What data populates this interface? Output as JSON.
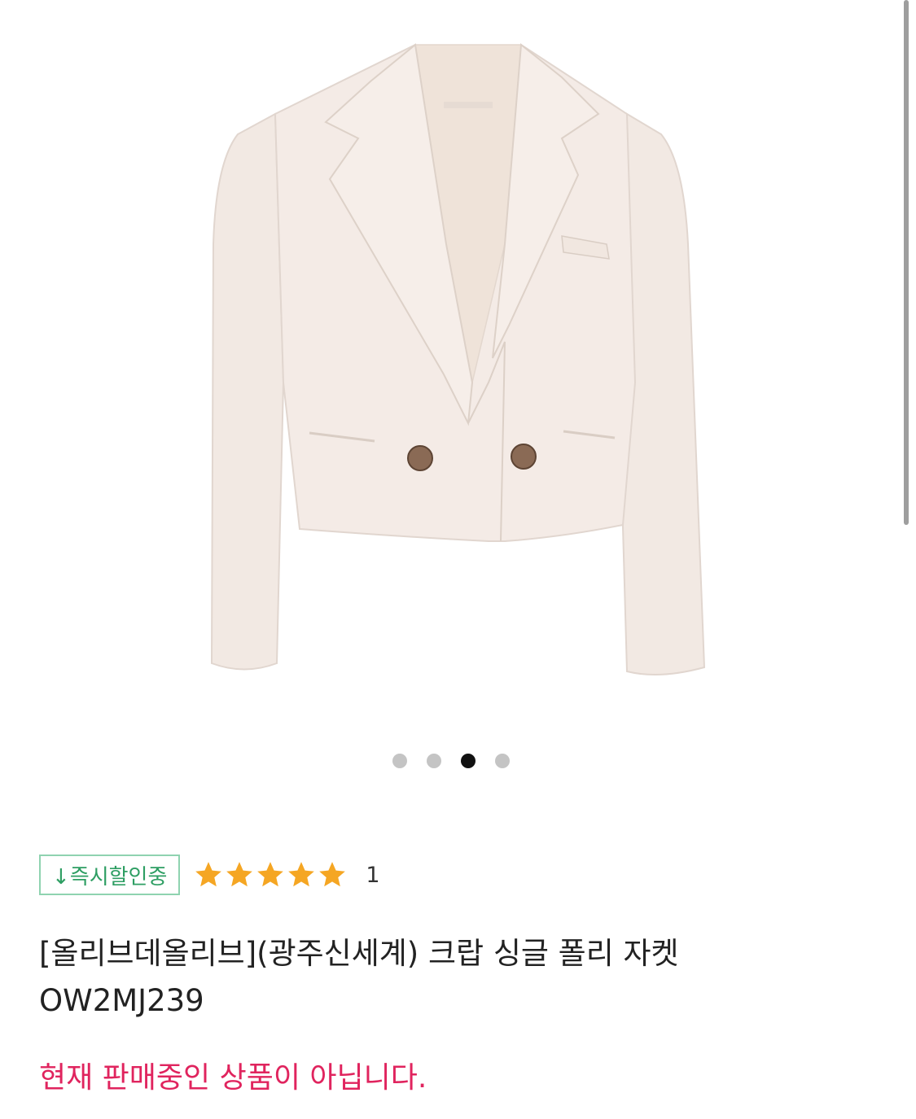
{
  "product": {
    "image_alt": "크랍 싱글 폴리 자켓",
    "carousel": {
      "total": 4,
      "active_index": 2
    },
    "badge_label": "↓즉시할인중",
    "rating": {
      "stars": 5,
      "max": 5,
      "review_count": "1"
    },
    "title": "[올리브데올리브](광주신세계) 크랍 싱글 폴리 자켓",
    "code": "OW2MJ239",
    "status": "현재 판매중인 상품이 아닙니다."
  },
  "colors": {
    "badge_border": "#8fd3b0",
    "badge_text": "#2e9e63",
    "star": "#f5a623",
    "status_text": "#e0245e",
    "jacket": "#f4ebe6",
    "button": "#8a6a55"
  },
  "icons": {
    "star": "star-icon"
  }
}
